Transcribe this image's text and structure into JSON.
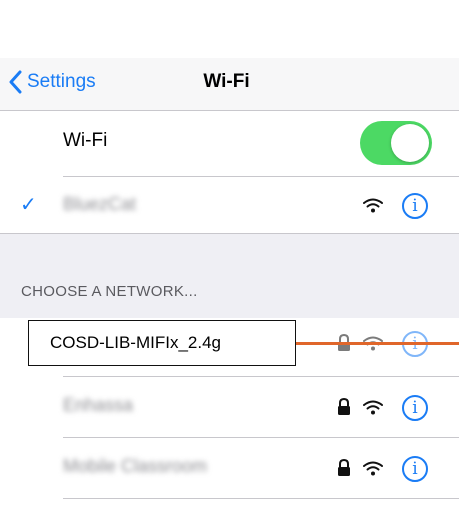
{
  "navbar": {
    "back_label": "Settings",
    "title": "Wi-Fi"
  },
  "wifi_toggle": {
    "label": "Wi-Fi",
    "state": "on",
    "color": "#4cd964"
  },
  "connected_network": {
    "name": "BluezCat",
    "checkmark": "✓"
  },
  "section": {
    "header": "CHOOSE A NETWORK..."
  },
  "networks": [
    {
      "name": "COSD-LIB-MIFIx_2.4g",
      "locked": true,
      "signal": "wifi-icon"
    },
    {
      "name": "Enhassa",
      "locked": true,
      "signal": "wifi-icon"
    },
    {
      "name": "Mobile Classroom",
      "locked": true,
      "signal": "wifi-icon"
    }
  ],
  "info_glyph": "i",
  "lock_glyph": "🔒",
  "colors": {
    "accent": "#1a7cf5",
    "toggle_on": "#4cd964",
    "annotation_line": "#e0662a",
    "group_background": "#efeff4"
  }
}
